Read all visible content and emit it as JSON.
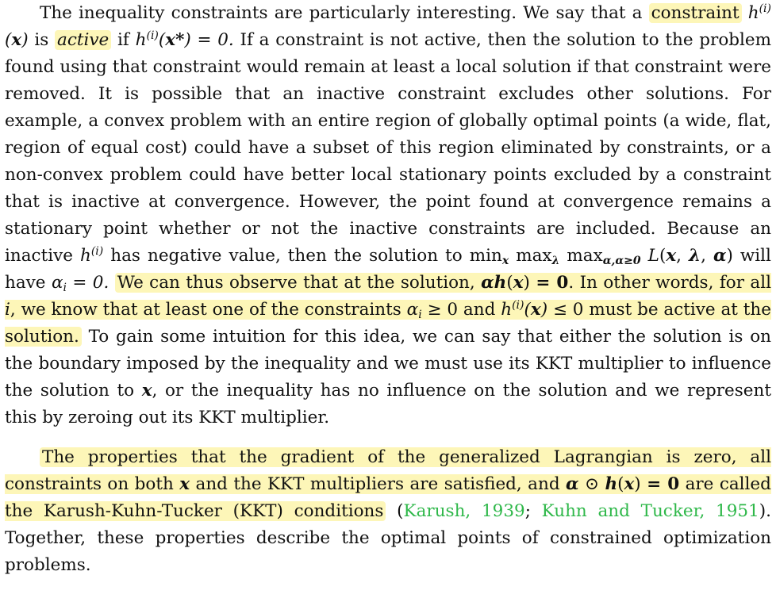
{
  "paragraph1": {
    "s1": "The inequality constraints are particularly interesting. We say that a",
    "constraint_word": "constraint",
    "h": "h",
    "sup_i": "(i)",
    "x": "x",
    "is": "is",
    "active": "active",
    "if": "if",
    "xstar": "x*",
    "eq0": ") = 0.",
    "s2": "If a constraint is not active, then the solution to the problem found using that constraint would remain at least a local solution if that constraint were removed. It is possible that an inactive constraint excludes other solutions. For example, a convex problem with an entire region of globally optimal points (a wide, flat, region of equal cost) could have a subset of this region eliminated by constraints, or a non-convex problem could have better local stationary points excluded by a constraint that is inactive at convergence. However, the point found at convergence remains a stationary point whether or not the inactive constraints are included. Because an inactive",
    "s3": "has negative value, then the solution to",
    "min": "min",
    "max": "max",
    "lambda": "λ",
    "alpha": "α",
    "ageq0": "α,α≥0",
    "L": "L",
    "s4": "will have",
    "alpha_i": "α",
    "i": "i",
    "eq_0": "= 0.",
    "hl1": "We can thus observe that at the solution,",
    "alpha_h": "αh",
    "eq_zero": "= 0",
    "hl2": ". In other words, for all",
    "hl3": ", we know that at least one of the constraints",
    "geq0": "≥ 0 and",
    "leq0": "≤ 0 must be active at the solution.",
    "s5": "To gain some intuition for this idea, we can say that either the solution is on the boundary imposed by the inequality and we must use its KKT multiplier to influence the solution to",
    "s6": ", or the inequality has no influence on the solution and we represent this by zeroing out its KKT multiplier."
  },
  "paragraph2": {
    "hl1": "The properties that the gradient of the generalized Lagrangian is zero, all constraints on both",
    "hl2": "and the KKT multipliers are satisfied, and",
    "odot": "⊙",
    "zero_vec": "= 0",
    "hl3": "are called the Karush-Kuhn-Tucker (KKT) conditions",
    "open_paren": "(",
    "cite1": "Karush, 1939",
    "semicolon": "; ",
    "cite2": "Kuhn and Tucker, 1951",
    "rest": "). Together, these properties describe the optimal points of constrained optimization problems."
  }
}
